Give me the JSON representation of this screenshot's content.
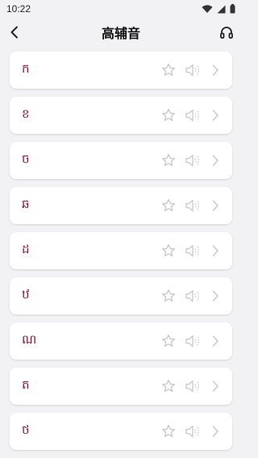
{
  "status": {
    "time": "10:22"
  },
  "header": {
    "title": "高辅音"
  },
  "items": [
    {
      "letter": "ក"
    },
    {
      "letter": "ខ"
    },
    {
      "letter": "ច"
    },
    {
      "letter": "ឆ"
    },
    {
      "letter": "ដ"
    },
    {
      "letter": "ឋ"
    },
    {
      "letter": "ណ"
    },
    {
      "letter": "ត"
    },
    {
      "letter": "ថ"
    }
  ],
  "icons": {
    "back": "back-arrow-icon",
    "headset": "headphones-icon",
    "star": "star-icon",
    "speaker": "speaker-icon",
    "chevron": "chevron-right-icon"
  },
  "colors": {
    "letter": "#8a1538",
    "icon": "#c8c8c8",
    "background": "#f2f2f4"
  }
}
